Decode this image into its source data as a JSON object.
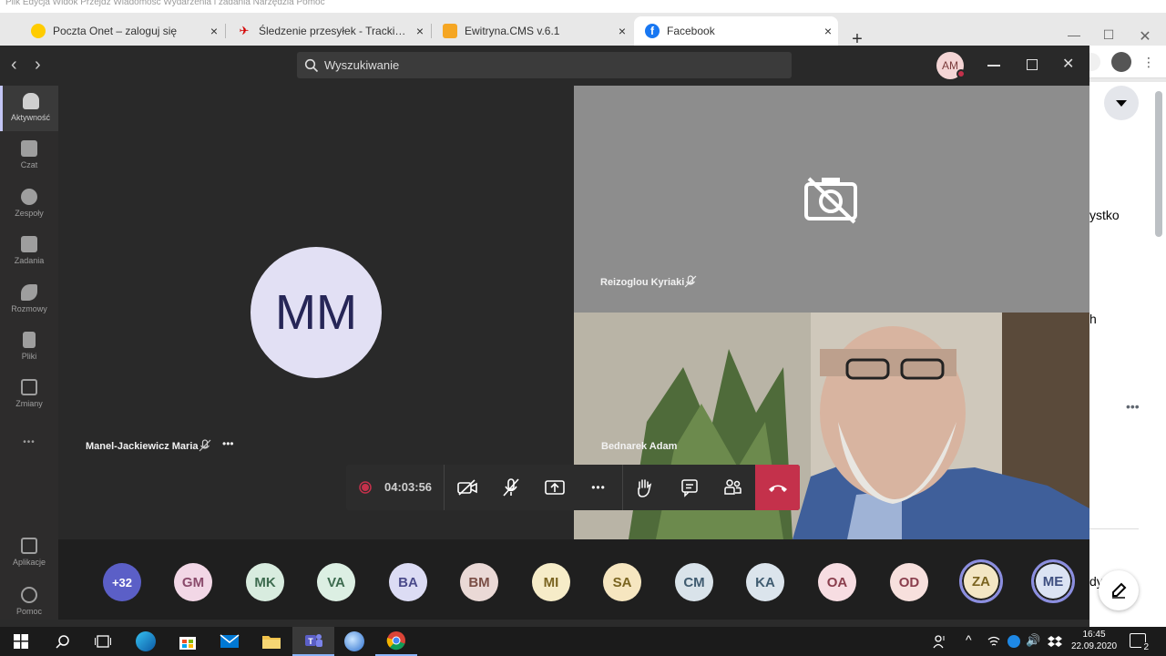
{
  "browser": {
    "menubar_ghost": "Plik Edycja Widok Przejdź Wiadomość Wydarzenia i zadania Narzędzia Pomoc",
    "tabs": [
      {
        "title": "Poczta Onet – zaloguj się",
        "favicon_color": "#ffcc00"
      },
      {
        "title": "Śledzenie przesyłek - Tracking | e",
        "favicon_color": "#d40000"
      },
      {
        "title": "Ewitryna.CMS v.6.1",
        "favicon_color": "#f5a623"
      },
      {
        "title": "Facebook",
        "favicon_color": "#1877f2"
      }
    ],
    "active_tab": 3,
    "new_tab": "+",
    "tab_close": "×",
    "peek": {
      "text1": "ystko",
      "text2": "h",
      "text3": "dy"
    }
  },
  "teams": {
    "search_placeholder": "Wyszukiwanie",
    "user_initials": "AM",
    "nav_back": "‹",
    "nav_forward": "›",
    "rail": [
      {
        "label": "Aktywność",
        "icon": "bell-icon"
      },
      {
        "label": "Czat",
        "icon": "chat-icon"
      },
      {
        "label": "Zespoły",
        "icon": "teams-icon"
      },
      {
        "label": "Zadania",
        "icon": "tasks-icon"
      },
      {
        "label": "Rozmowy",
        "icon": "phone-icon"
      },
      {
        "label": "Pliki",
        "icon": "files-icon"
      },
      {
        "label": "Zmiany",
        "icon": "shifts-icon"
      }
    ],
    "rail_more": "•••",
    "rail_bottom": [
      {
        "label": "Aplikacje",
        "icon": "apps-icon"
      },
      {
        "label": "Pomoc",
        "icon": "help-icon"
      }
    ],
    "participants": {
      "left": {
        "initials": "MM",
        "name": "Manel-Jackiewicz Maria"
      },
      "right_top": {
        "name": "Reizoglou Kyriaki"
      },
      "right_bottom": {
        "name": "Bednarek Adam"
      }
    },
    "call_timer": "04:03:56",
    "more_dots": "•••",
    "roster": [
      {
        "initials": "+32",
        "bg": "#5b5fc7",
        "fg": "#ffffff"
      },
      {
        "initials": "GM",
        "bg": "#f2d7e6",
        "fg": "#8a4a6b"
      },
      {
        "initials": "MK",
        "bg": "#d8ecdf",
        "fg": "#3d6b4f"
      },
      {
        "initials": "VA",
        "bg": "#dcefe3",
        "fg": "#3d6b4f"
      },
      {
        "initials": "BA",
        "bg": "#dcdcf4",
        "fg": "#4a4a8a"
      },
      {
        "initials": "BM",
        "bg": "#ead9d6",
        "fg": "#7a4e45"
      },
      {
        "initials": "MI",
        "bg": "#f6ecc8",
        "fg": "#7a6420"
      },
      {
        "initials": "SA",
        "bg": "#f6e6c0",
        "fg": "#7a6420"
      },
      {
        "initials": "CM",
        "bg": "#d9e3ea",
        "fg": "#3f5b70"
      },
      {
        "initials": "KA",
        "bg": "#dbe4ec",
        "fg": "#3f5b70"
      },
      {
        "initials": "OA",
        "bg": "#f7dde2",
        "fg": "#8a3e4d"
      },
      {
        "initials": "OD",
        "bg": "#f7e0dd",
        "fg": "#8a3e4d"
      },
      {
        "initials": "ZA",
        "bg": "#f3e6c4",
        "fg": "#7a6420"
      },
      {
        "initials": "ME",
        "bg": "#dbe3f3",
        "fg": "#3e4f80"
      }
    ],
    "colors": {
      "accent": "#c3c6f5",
      "hangup": "#c4314b",
      "record": "#c4314b"
    }
  },
  "taskbar": {
    "time": "16:45",
    "date": "22.09.2020",
    "notification_count": "2"
  }
}
